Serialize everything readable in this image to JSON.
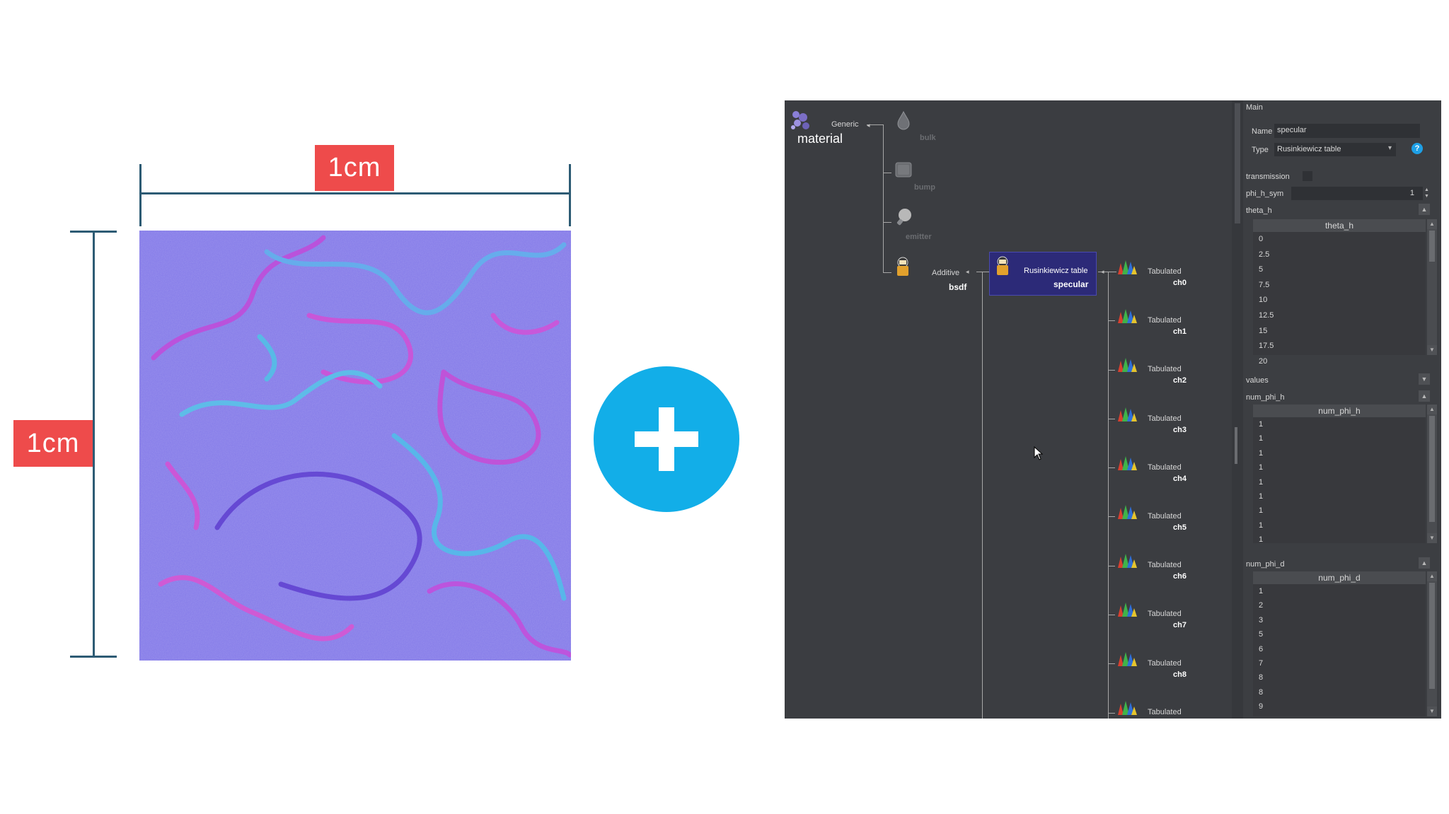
{
  "figure": {
    "width_label": "1cm",
    "height_label": "1cm",
    "plus_symbol": "plus-icon",
    "colors": {
      "dimension_line": "#2d5b74",
      "label_bg": "#ee4b4b",
      "plus_bg": "#12aee8",
      "texture_base": "#8278e8"
    }
  },
  "graph": {
    "material": {
      "title": "Generic",
      "name": "material",
      "icon": "material-icon"
    },
    "children": [
      {
        "label": "bulk",
        "icon": "droplet-icon"
      },
      {
        "label": "bump",
        "icon": "bump-icon"
      },
      {
        "label": "emitter",
        "icon": "bulb-icon"
      }
    ],
    "bsdf": {
      "title": "Additive",
      "name": "bsdf",
      "icon": "bsdf-icon"
    },
    "specular": {
      "title": "Rusinkiewicz table",
      "name": "specular",
      "icon": "bsdf-icon"
    },
    "tabulated": [
      {
        "title": "Tabulated",
        "name": "ch0"
      },
      {
        "title": "Tabulated",
        "name": "ch1"
      },
      {
        "title": "Tabulated",
        "name": "ch2"
      },
      {
        "title": "Tabulated",
        "name": "ch3"
      },
      {
        "title": "Tabulated",
        "name": "ch4"
      },
      {
        "title": "Tabulated",
        "name": "ch5"
      },
      {
        "title": "Tabulated",
        "name": "ch6"
      },
      {
        "title": "Tabulated",
        "name": "ch7"
      },
      {
        "title": "Tabulated",
        "name": "ch8"
      },
      {
        "title": "Tabulated",
        "name": ""
      }
    ],
    "colors": {
      "background": "#3b3d41",
      "selected": "#2c2a78"
    }
  },
  "props": {
    "section": "Main",
    "name_label": "Name",
    "name_value": "specular",
    "type_label": "Type",
    "type_value": "Rusinkiewicz table",
    "help_icon": "help-icon",
    "transmission_label": "transmission",
    "phi_h_sym_label": "phi_h_sym",
    "phi_h_sym_value": "1",
    "theta_h_label": "theta_h",
    "theta_h_header": "theta_h",
    "theta_h_values": [
      "0",
      "2.5",
      "5",
      "7.5",
      "10",
      "12.5",
      "15",
      "17.5",
      "20"
    ],
    "values_label": "values",
    "num_phi_h_label": "num_phi_h",
    "num_phi_h_header": "num_phi_h",
    "num_phi_h_values": [
      "1",
      "1",
      "1",
      "1",
      "1",
      "1",
      "1",
      "1",
      "1"
    ],
    "num_phi_d_label": "num_phi_d",
    "num_phi_d_header": "num_phi_d",
    "num_phi_d_values": [
      "1",
      "2",
      "3",
      "5",
      "6",
      "7",
      "8",
      "8",
      "9"
    ]
  }
}
